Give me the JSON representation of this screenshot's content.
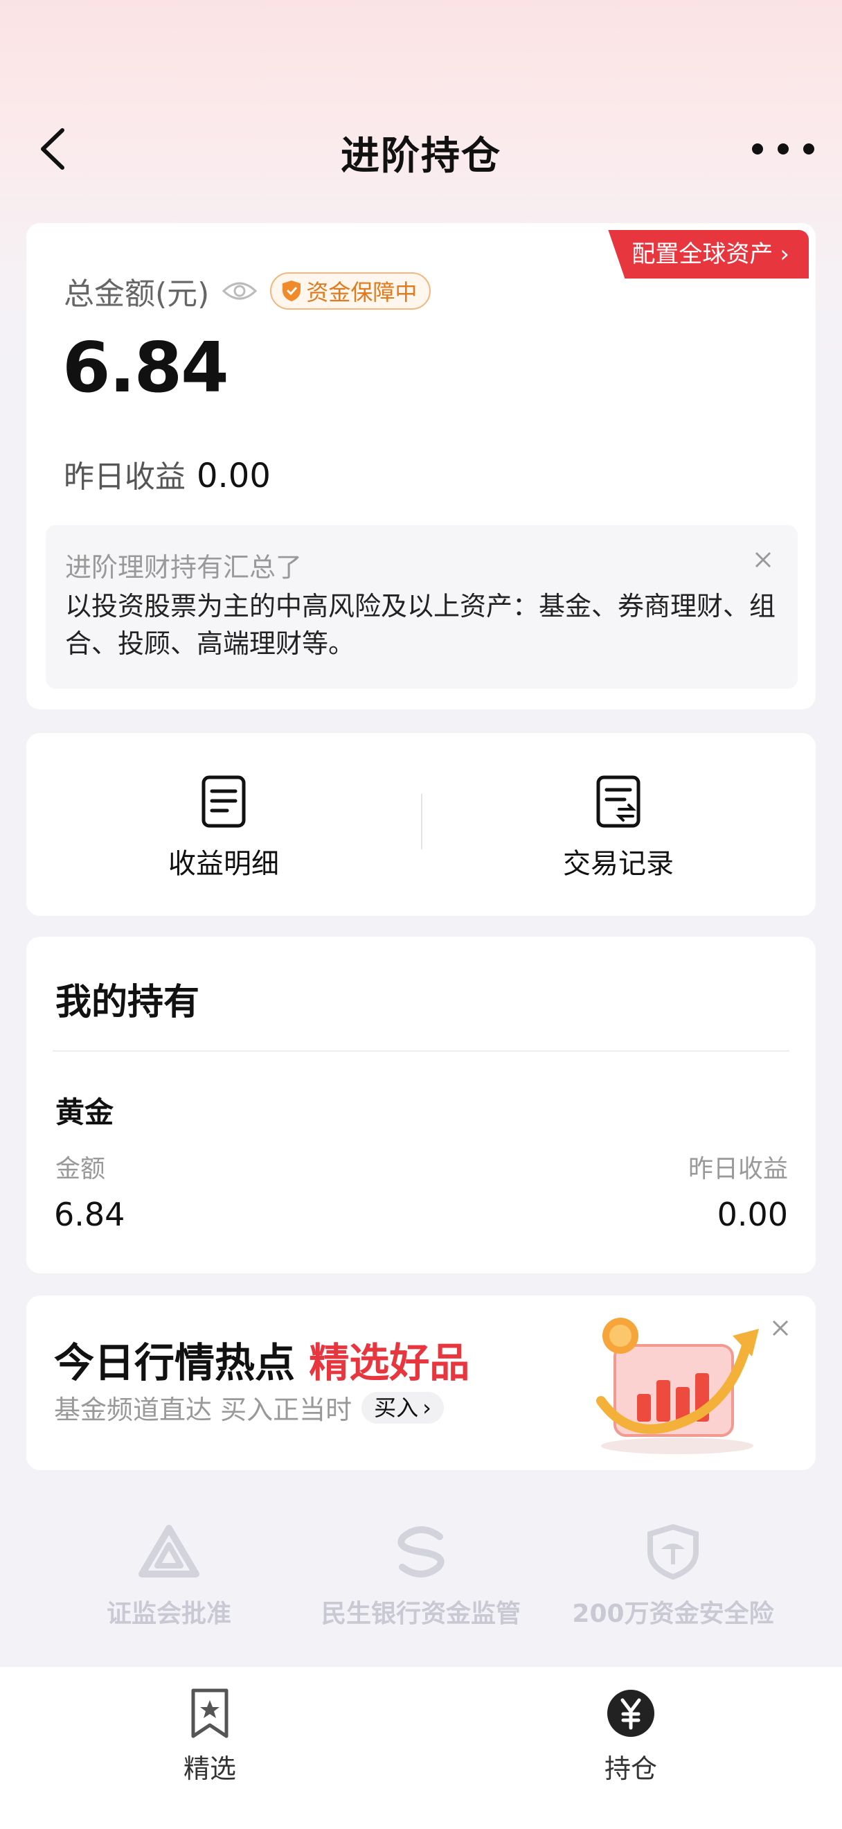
{
  "nav": {
    "title": "进阶持仓"
  },
  "summary": {
    "global_tag": "配置全球资产",
    "total_label": "总金额(元)",
    "guard_badge": "资金保障中",
    "total_value": "6.84",
    "yesterday_label": "昨日收益",
    "yesterday_value": "0.00",
    "notice_title": "进阶理财持有汇总了",
    "notice_body": "以投资股票为主的中高风险及以上资产：基金、券商理财、组合、投顾、高端理财等。"
  },
  "actions": [
    {
      "label": "收益明细",
      "icon": "document-icon"
    },
    {
      "label": "交易记录",
      "icon": "exchange-record-icon"
    }
  ],
  "holdings": {
    "title": "我的持有",
    "items": [
      {
        "name": "黄金",
        "amount_label": "金额",
        "amount": "6.84",
        "yday_label": "昨日收益",
        "yday": "0.00"
      }
    ]
  },
  "promo": {
    "title_main": "今日行情热点",
    "title_highlight": "精选好品",
    "subtitle": "基金频道直达 买入正当时",
    "buy_label": "买入"
  },
  "trust": [
    {
      "label": "证监会批准",
      "icon": "csrc-logo-icon"
    },
    {
      "label": "民生银行资金监管",
      "icon": "minsheng-logo-icon"
    },
    {
      "label": "200万资金安全险",
      "icon": "insurance-shield-icon"
    }
  ],
  "tabbar": [
    {
      "label": "精选",
      "icon": "bookmark-star-icon"
    },
    {
      "label": "持仓",
      "icon": "yuan-coin-icon"
    }
  ],
  "colors": {
    "accent_red": "#e8363f",
    "badge_orange": "#e07a1c",
    "page_bg": "#f3f2f7"
  }
}
